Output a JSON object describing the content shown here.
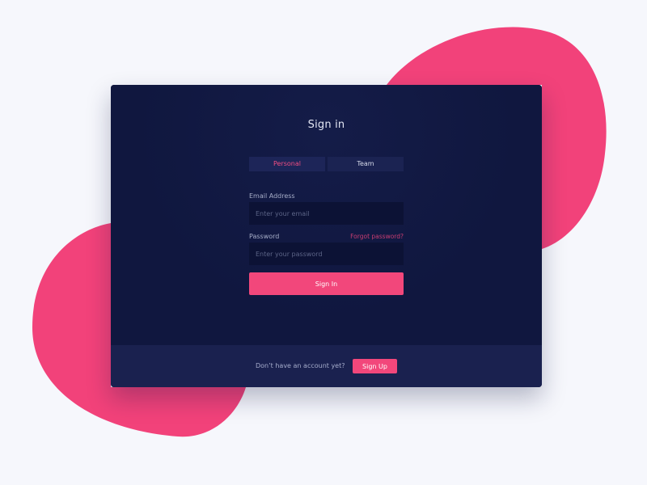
{
  "colors": {
    "page_background": "#f6f7fc",
    "accent": "#f2477b",
    "card_background": "#10173f",
    "footer_background": "#1a214f"
  },
  "signin": {
    "title": "Sign in",
    "tabs": [
      {
        "label": "Personal",
        "active": true
      },
      {
        "label": "Team",
        "active": false
      }
    ],
    "email": {
      "label": "Email Address",
      "value": "",
      "placeholder": "Enter your email"
    },
    "password": {
      "label": "Password",
      "value": "",
      "placeholder": "Enter your password"
    },
    "forgot_link": "Forgot password?",
    "submit_label": "Sign In"
  },
  "footer": {
    "prompt": "Don’t have an account yet?",
    "signup_label": "Sign Up"
  }
}
